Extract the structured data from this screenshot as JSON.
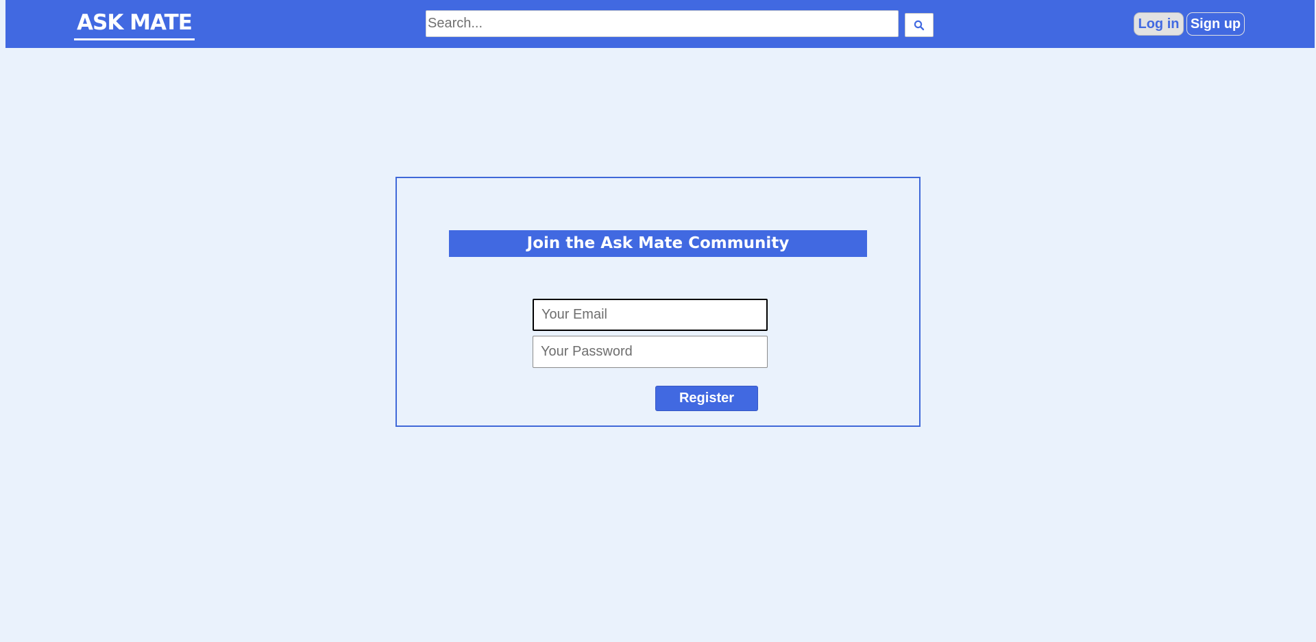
{
  "header": {
    "logo": "ASK MATE",
    "search": {
      "placeholder": "Search...",
      "value": "",
      "button_icon": "search-icon"
    },
    "login_label": "Log in",
    "signup_label": "Sign up"
  },
  "register": {
    "title": "Join the Ask Mate Community",
    "email": {
      "placeholder": "Your Email",
      "value": ""
    },
    "password": {
      "placeholder": "Your Password",
      "value": ""
    },
    "submit_label": "Register"
  },
  "colors": {
    "brand": "#4169e1",
    "background": "#eaf2fc",
    "login_button_bg": "#e2e2e2"
  }
}
